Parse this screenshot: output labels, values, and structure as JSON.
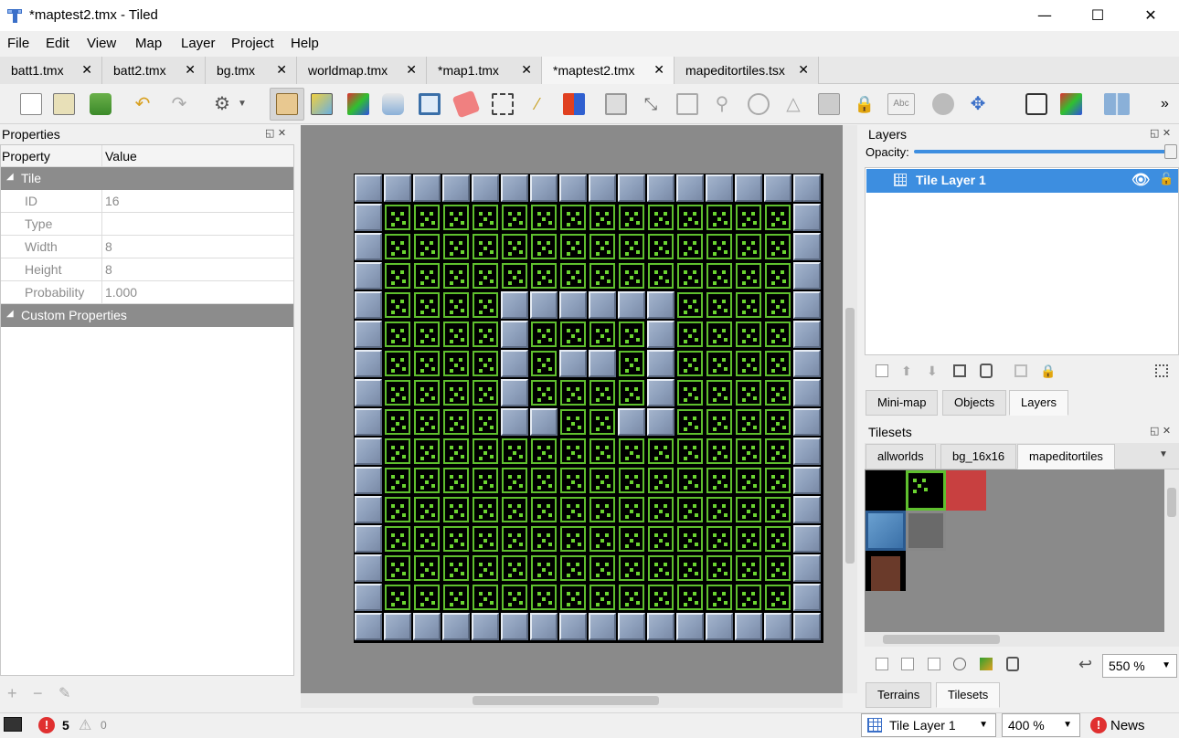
{
  "window": {
    "title": "*maptest2.tmx - Tiled",
    "minimize": "—",
    "maximize": "☐",
    "close": "✕"
  },
  "menu": [
    "File",
    "Edit",
    "View",
    "Map",
    "Layer",
    "Project",
    "Help"
  ],
  "tabs": [
    "batt1.tmx",
    "batt2.tmx",
    "bg.tmx",
    "worldmap.tmx",
    "*map1.tmx",
    "*maptest2.tmx",
    "mapeditortiles.tsx"
  ],
  "active_tab": "*maptest2.tmx",
  "toolbar": {
    "overflow": "»"
  },
  "properties": {
    "title": "Properties",
    "col_property": "Property",
    "col_value": "Value",
    "group_tile": "Tile",
    "rows": [
      {
        "key": "ID",
        "value": "16"
      },
      {
        "key": "Type",
        "value": ""
      },
      {
        "key": "Width",
        "value": "8"
      },
      {
        "key": "Height",
        "value": "8"
      },
      {
        "key": "Probability",
        "value": "1.000"
      }
    ],
    "group_custom": "Custom Properties"
  },
  "layers_panel": {
    "title": "Layers",
    "opacity_label": "Opacity:",
    "opacity": 1.0,
    "layer_name": "Tile Layer 1",
    "tabs": [
      "Mini-map",
      "Objects",
      "Layers"
    ],
    "active_tab": "Layers"
  },
  "tilesets_panel": {
    "title": "Tilesets",
    "tabs": [
      "allworlds",
      "bg_16x16",
      "mapeditortiles"
    ],
    "active_tab": "mapeditortiles",
    "zoom": "550 %",
    "bottom_tabs": [
      "Terrains",
      "Tilesets"
    ],
    "active_bottom_tab": "Tilesets"
  },
  "status": {
    "errors": "5",
    "warnings": "0",
    "layer_combo": "Tile Layer 1",
    "zoom_combo": "400 %",
    "news": "News"
  },
  "colors": {
    "accent": "#3d8ee0",
    "grass": "#5fbf2e",
    "wall": "#8ea0bc",
    "error": "#e03030"
  }
}
